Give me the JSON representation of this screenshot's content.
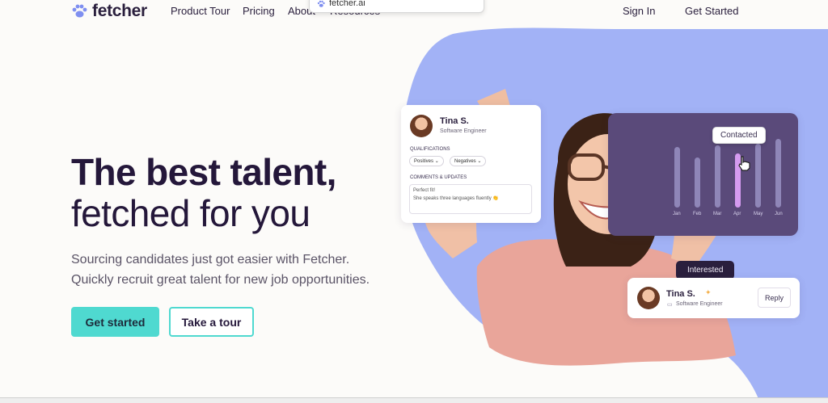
{
  "nav": {
    "brand": "fetcher",
    "links": [
      "Product Tour",
      "Pricing",
      "About",
      "Resources"
    ],
    "sign_in": "Sign In",
    "get_started": "Get Started"
  },
  "tab_popup": {
    "title": "fetcher.ai"
  },
  "hero": {
    "title_bold": "The best talent,",
    "title_light": "fetched for you",
    "subtitle_line1": "Sourcing candidates just got easier with Fetcher.",
    "subtitle_line2": "Quickly recruit great talent for new job opportunities.",
    "primary_cta": "Get started",
    "secondary_cta": "Take a tour"
  },
  "profile_card": {
    "name": "Tina S.",
    "role": "Software Engineer",
    "qualifications_label": "QUALIFICATIONS",
    "positives": "Positives",
    "negatives": "Negatives",
    "comments_label": "COMMENTS & UPDATES",
    "comment_line1": "Perfect fit!",
    "comment_line2": "She speaks three languages fluently 👏"
  },
  "chart_card": {
    "tooltip": "Contacted",
    "months": [
      "Jan",
      "Feb",
      "Mar",
      "Apr",
      "May",
      "Jun"
    ]
  },
  "status_card": {
    "badge": "Interested",
    "name": "Tina S.",
    "role": "Software Engineer",
    "reply": "Reply"
  },
  "colors": {
    "accent": "#4fd9d0",
    "dark": "#24173a",
    "blob": "#9fb0f7",
    "chart_bg": "#5a4a7a"
  }
}
